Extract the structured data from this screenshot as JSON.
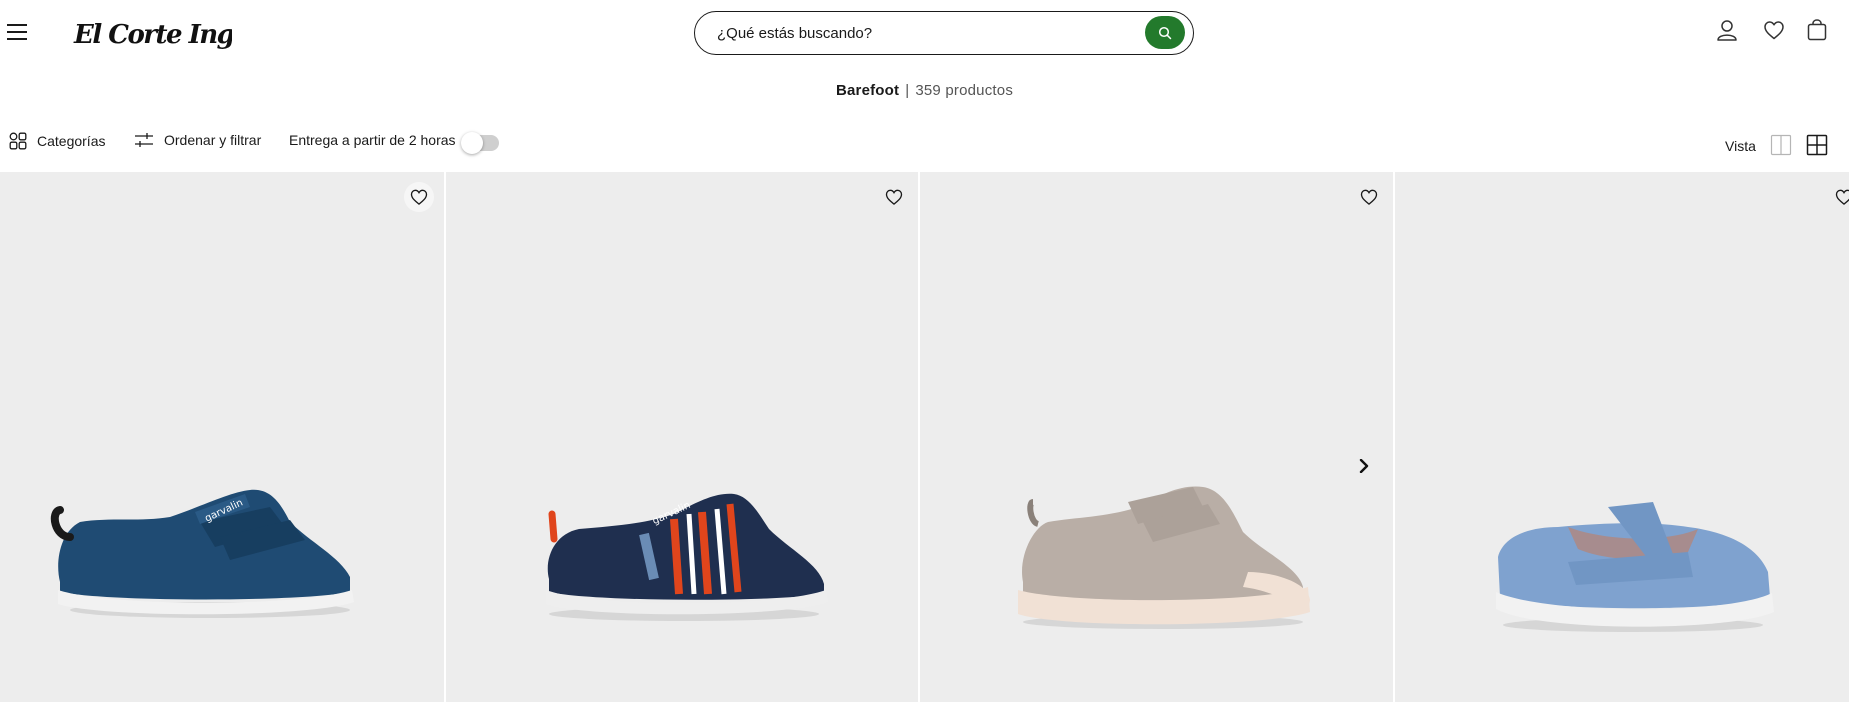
{
  "header": {
    "menu_icon": "hamburger-menu-icon",
    "logo_text": "El Corte Inglés",
    "search": {
      "placeholder": "¿Qué estás buscando?",
      "value": "",
      "button_icon": "search-icon"
    },
    "icons": [
      "user-icon",
      "heart-icon",
      "shopping-bag-icon"
    ]
  },
  "page": {
    "title": "Barefoot",
    "separator": "|",
    "count": "359",
    "count_label": "productos"
  },
  "filters": {
    "categories_label": "Categorías",
    "sort_filter_label": "Ordenar y filtrar",
    "delivery_label": "Entrega a partir de 2 horas",
    "delivery_toggle_on": false,
    "view_label": "Vista",
    "view_options": [
      "single-column-view-icon",
      "grid-view-icon"
    ]
  },
  "products": [
    {
      "shoe": "navy blue canvas sneaker with velcro straps",
      "main_color": "#1f4b73",
      "sole_color": "#f2f2f2"
    },
    {
      "shoe": "navy sneaker with orange and white stripes and bungee laces",
      "main_color": "#1f2f4f",
      "accent_color": "#e0451c",
      "sole_color": "#eeeeee"
    },
    {
      "shoe": "beige canvas sneaker with double velcro straps",
      "main_color": "#b9aea6",
      "sole_color": "#f1e1d5"
    },
    {
      "shoe": "light blue corduroy t-bar mary jane",
      "main_color": "#7fa2cf",
      "sole_color": "#f2f2f2"
    }
  ],
  "colors": {
    "accent_green": "#237a2c",
    "card_bg": "#ededed",
    "text": "#1a1a1a"
  }
}
